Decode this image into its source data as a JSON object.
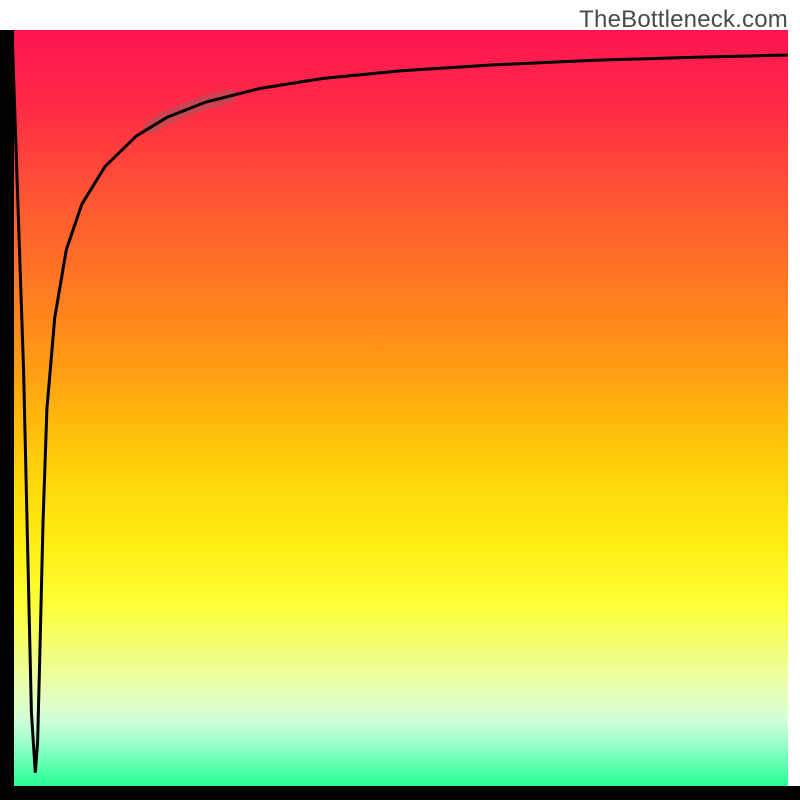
{
  "watermark": "TheBottleneck.com",
  "chart_data": {
    "type": "line",
    "title": "",
    "xlabel": "",
    "ylabel": "",
    "xlim": [
      0,
      100
    ],
    "ylim": [
      0,
      100
    ],
    "grid": false,
    "series": [
      {
        "name": "main-curve",
        "x": [
          0,
          1.5,
          2.5,
          3.0,
          3.3,
          3.6,
          4.0,
          4.5,
          5.5,
          7,
          9,
          12,
          16,
          20,
          25,
          32,
          40,
          50,
          62,
          75,
          88,
          100
        ],
        "y": [
          100,
          55,
          10,
          2,
          6,
          18,
          35,
          50,
          62,
          71,
          77,
          82,
          86,
          88.5,
          90.5,
          92.3,
          93.6,
          94.6,
          95.4,
          96.0,
          96.4,
          96.7
        ]
      }
    ],
    "highlight_segment": {
      "series": "main-curve",
      "x_range": [
        18,
        28
      ],
      "note": "thicker faded stroke overlay"
    },
    "background_gradient": {
      "direction": "top-to-bottom",
      "stops": [
        {
          "pos": 0.0,
          "color": "#ff1450"
        },
        {
          "pos": 0.5,
          "color": "#ffbb0c"
        },
        {
          "pos": 0.75,
          "color": "#fdff3a"
        },
        {
          "pos": 1.0,
          "color": "#1fff90"
        }
      ]
    }
  }
}
